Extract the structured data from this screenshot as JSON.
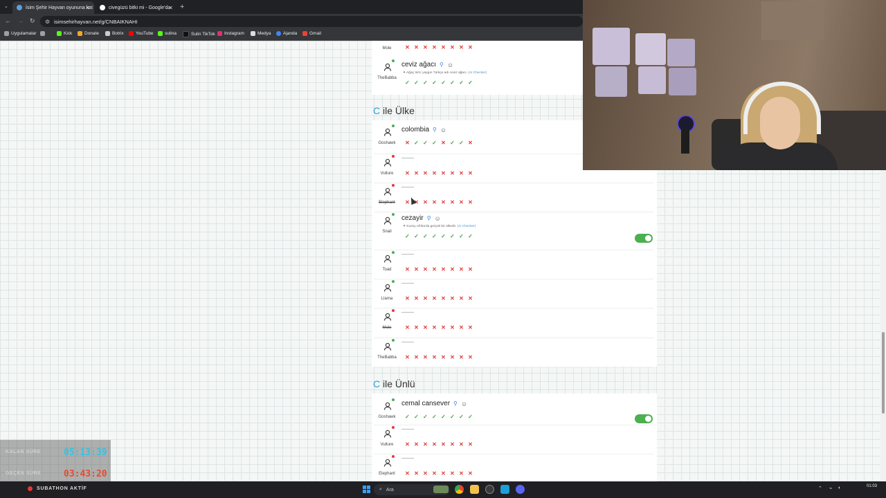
{
  "browser": {
    "tabs": [
      {
        "title": "İsim Şehir Hayvan oyununa kat",
        "active": true
      },
      {
        "title": "civegüzü bitki mi - Google'da",
        "active": false
      }
    ],
    "url": "isimsehirhayvan.net/g/CNBAIKNAHI",
    "bookmarks": [
      "Uygulamalar",
      "Kick",
      "Donate",
      "Botrix",
      "YouTube",
      "sulina",
      "Sulin TikTok",
      "Instagram",
      "Medya",
      "Ajanda",
      "Gmail"
    ]
  },
  "game": {
    "top_card": {
      "prev_player": "Mole",
      "prev_votes": [
        "x",
        "x",
        "x",
        "x",
        "x",
        "x",
        "x",
        "x"
      ],
      "row": {
        "player": "TheBabba",
        "status": "g",
        "answer": "ceviz ağacı",
        "note": "Ağaç türü; yaygın Türkçe adı ceviz ağacı.",
        "note_tag": "(Ai Checker)",
        "votes": [
          "c",
          "c",
          "c",
          "c",
          "c",
          "c",
          "c",
          "c"
        ]
      }
    },
    "section_country": {
      "letter": "C",
      "title": "ile Ülke",
      "rows": [
        {
          "player": "Goshawk",
          "status": "g",
          "answer": "colombia",
          "votes": [
            "x",
            "c",
            "c",
            "c",
            "x",
            "c",
            "c",
            "x"
          ]
        },
        {
          "player": "Vulture",
          "status": "r",
          "answer": "",
          "votes": [
            "x",
            "x",
            "x",
            "x",
            "x",
            "x",
            "x",
            "x"
          ]
        },
        {
          "player": "Elephant",
          "status": "r",
          "answer": "",
          "strike": true,
          "votes": [
            "x",
            "x",
            "x",
            "x",
            "x",
            "x",
            "x",
            "x"
          ]
        },
        {
          "player": "Snail",
          "status": "g",
          "answer": "cezayir",
          "note": "Kuzey Afrika'da gerçek bir ülkedir.",
          "note_tag": "(Ai Checker)",
          "votes": [
            "c",
            "c",
            "c",
            "c",
            "c",
            "c",
            "c",
            "c"
          ],
          "toggle": true
        },
        {
          "player": "Toad",
          "status": "g",
          "answer": "",
          "votes": [
            "x",
            "x",
            "x",
            "x",
            "x",
            "x",
            "x",
            "x"
          ]
        },
        {
          "player": "Llama",
          "status": "g",
          "answer": "",
          "votes": [
            "x",
            "x",
            "x",
            "x",
            "x",
            "x",
            "x",
            "x"
          ]
        },
        {
          "player": "Mole",
          "status": "r",
          "answer": "",
          "strike": true,
          "votes": [
            "x",
            "x",
            "x",
            "x",
            "x",
            "x",
            "x",
            "x"
          ]
        },
        {
          "player": "TheBabba",
          "status": "g",
          "answer": "",
          "votes": [
            "x",
            "x",
            "x",
            "x",
            "x",
            "x",
            "x",
            "x"
          ]
        }
      ]
    },
    "section_famous": {
      "letter": "C",
      "title": "ile Ünlü",
      "rows": [
        {
          "player": "Goshawk",
          "status": "g",
          "answer": "cemal cansever",
          "votes": [
            "c",
            "c",
            "c",
            "c",
            "c",
            "c",
            "c",
            "c"
          ],
          "toggle": true
        },
        {
          "player": "Vulture",
          "status": "r",
          "answer": "",
          "votes": [
            "x",
            "x",
            "x",
            "x",
            "x",
            "x",
            "x",
            "x"
          ]
        },
        {
          "player": "Elephant",
          "status": "r",
          "answer": "",
          "votes": [
            "x",
            "x",
            "x",
            "x",
            "x",
            "x",
            "x",
            "x"
          ]
        }
      ]
    }
  },
  "overlay": {
    "remaining_label": "KALAN SÜRE",
    "remaining_value": "05:13:39",
    "remaining_color": "#2ec4e8",
    "elapsed_label": "GEÇEN SÜRE",
    "elapsed_value": "03:43:20",
    "elapsed_color": "#e84a2e",
    "subathon": "SUBATHON AKTİF"
  },
  "taskbar": {
    "search_placeholder": "Ara",
    "time": "01:03"
  },
  "icons": {
    "vote_cross": "✕",
    "vote_check": "✓"
  }
}
